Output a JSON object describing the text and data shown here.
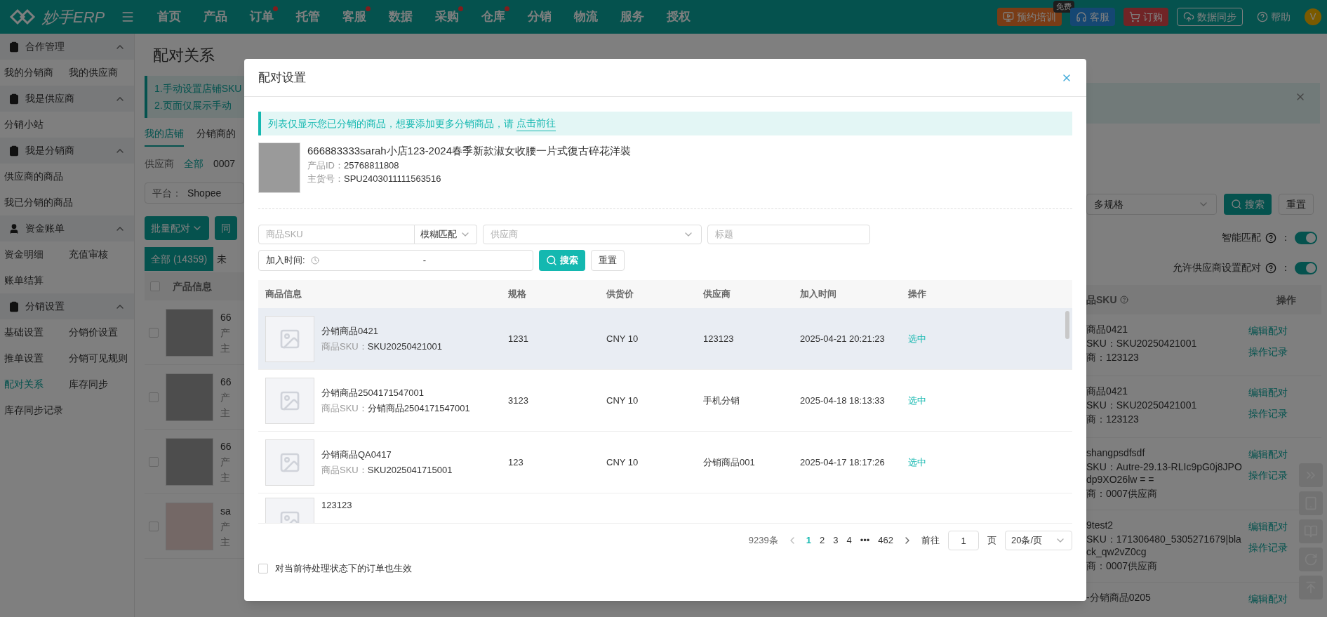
{
  "top_bar": {
    "logo": "妙手ERP",
    "nav": [
      {
        "label": "首页",
        "dot": false
      },
      {
        "label": "产品",
        "dot": false
      },
      {
        "label": "订单",
        "dot": true
      },
      {
        "label": "托管",
        "dot": false
      },
      {
        "label": "客服",
        "dot": true
      },
      {
        "label": "数据",
        "dot": false
      },
      {
        "label": "采购",
        "dot": true
      },
      {
        "label": "仓库",
        "dot": true
      },
      {
        "label": "分销",
        "dot": false
      },
      {
        "label": "物流",
        "dot": false
      },
      {
        "label": "服务",
        "dot": false
      },
      {
        "label": "授权",
        "dot": false
      }
    ],
    "actions": [
      {
        "kind": "training",
        "label": "预约培训",
        "badge": "免费"
      },
      {
        "kind": "service",
        "label": "客服"
      },
      {
        "kind": "order",
        "label": "订购"
      },
      {
        "kind": "sync",
        "label": "数据同步"
      },
      {
        "kind": "help",
        "label": "帮助"
      }
    ],
    "avatar": "V"
  },
  "sidebar": [
    {
      "title": "合作管理",
      "expanded": true,
      "items": [
        {
          "label": "我的分销商",
          "selected": false
        },
        {
          "label": "我的供应商",
          "selected": false
        }
      ]
    },
    {
      "title": "我是供应商",
      "expanded": true,
      "items": [
        {
          "label": "分销小站",
          "selected": false
        }
      ]
    },
    {
      "title": "我是分销商",
      "expanded": true,
      "items": [
        {
          "label": "供应商的商品",
          "selected": false
        },
        {
          "label": "我已分销的商品",
          "selected": false
        }
      ]
    },
    {
      "title": "资金账单",
      "expanded": true,
      "items": [
        {
          "label": "资金明细",
          "selected": false
        },
        {
          "label": "充值审核",
          "selected": false
        },
        {
          "label": "账单结算",
          "selected": false
        }
      ]
    },
    {
      "title": "分销设置",
      "expanded": true,
      "items": [
        {
          "label": "基础设置",
          "selected": false
        },
        {
          "label": "分销价设置",
          "selected": false
        },
        {
          "label": "推单设置",
          "selected": false
        },
        {
          "label": "分销可见规则",
          "selected": false
        },
        {
          "label": "配对关系",
          "selected": true
        },
        {
          "label": "库存同步",
          "selected": false
        },
        {
          "label": "库存同步记录",
          "selected": false
        }
      ]
    }
  ],
  "page_left": {
    "title": "配对关系",
    "notice_lines": [
      "1.手动设置店铺SKU",
      "2.页面仅展示手动"
    ],
    "tabs": [
      {
        "label": "我的店铺",
        "selected": true
      },
      {
        "label": "分销商的",
        "selected": false
      }
    ],
    "supplier_filter": {
      "label": "供应商",
      "options": [
        {
          "label": "全部",
          "selected": true
        },
        {
          "label": "0007",
          "selected": false
        }
      ]
    },
    "platform": {
      "label": "平台：",
      "value": "Shopee"
    },
    "buttons": [
      {
        "label": "批量配对",
        "caret": true
      },
      {
        "label": "同",
        "caret": false
      }
    ],
    "status_tabs": [
      {
        "label": "全部 (14359)",
        "selected": true
      },
      {
        "label": "未",
        "selected": false
      }
    ],
    "header_checked": false,
    "header": "产品信息",
    "rows": [
      {
        "checked": false,
        "kind": "dress",
        "lines": [
          "66",
          "产",
          "主"
        ]
      },
      {
        "checked": false,
        "kind": "dress",
        "lines": [
          "66",
          "产",
          "主"
        ]
      },
      {
        "checked": false,
        "kind": "dress",
        "lines": [
          "66",
          "产",
          "主"
        ]
      },
      {
        "checked": false,
        "kind": "fan",
        "lines": [
          "sa",
          "产",
          "主"
        ]
      }
    ]
  },
  "page_right": {
    "spec_select": "多规格",
    "search": "搜索",
    "reset": "重置",
    "switches": [
      {
        "label": "智能匹配",
        "colon": "：",
        "on": true
      },
      {
        "label": "允许供应商设置配对",
        "colon": "：",
        "on": true
      }
    ],
    "header": {
      "sku": "品SKU",
      "action": "操作"
    },
    "rows": [
      {
        "lines": [
          "商品0421",
          "SKU：SKU20250421001",
          "商：123123"
        ],
        "actions": [
          "编辑配对",
          "操作记录"
        ]
      },
      {
        "lines": [
          "商品0421",
          "SKU：SKU20250421001",
          "商：123123"
        ],
        "actions": [
          "编辑配对",
          "操作记录"
        ]
      },
      {
        "lines": [
          "shangpsdfsdf",
          "SKU：Autre-29.13-RLIc9pG0j8JPOdp9XO26lw = =",
          "商：0007供应商"
        ],
        "actions": [
          "编辑配对",
          "操作记录"
        ]
      },
      {
        "lines": [
          "9test2",
          "SKU：171306480_5305271679|black_qw2vZ0cg",
          "商：0007供应商"
        ],
        "actions": [
          "编辑配对",
          "操作记录"
        ]
      },
      {
        "lines": [
          "-分销商品0205"
        ],
        "actions": [
          "编辑配对"
        ]
      }
    ]
  },
  "modal": {
    "title": "配对设置",
    "notice": "列表仅显示您已分销的商品，想要添加更多分销商品，请",
    "notice_link": "点击前往",
    "product": {
      "title": "666883333sarah小店123-2024春季新款淑女收腰一片式復古碎花洋裝",
      "fields": [
        {
          "label": "产品ID：",
          "value": "25768811808"
        },
        {
          "label": "主货号：",
          "value": "SPU2403011111563516"
        }
      ]
    },
    "filters": {
      "sku_placeholder": "商品SKU",
      "match_mode": "模糊匹配",
      "supplier_placeholder": "供应商",
      "title_placeholder": "标题",
      "date_label": "加入时间:",
      "date_separator": "-",
      "search": "搜索",
      "reset": "重置"
    },
    "columns": [
      "商品信息",
      "规格",
      "供货价",
      "供应商",
      "加入时间",
      "操作"
    ],
    "rows": [
      {
        "name": "分销商品0421",
        "sku_label": "商品SKU：",
        "sku": "SKU20250421001",
        "spec": "1231",
        "price": "CNY 10",
        "supplier": "123123",
        "time": "2025-04-21 20:21:23",
        "action": "选中",
        "highlighted": true
      },
      {
        "name": "分销商品2504171547001",
        "sku_label": "商品SKU：",
        "sku": "分销商品2504171547001",
        "spec": "3123",
        "price": "CNY 10",
        "supplier": "手机分销",
        "time": "2025-04-18 18:13:33",
        "action": "选中",
        "highlighted": false
      },
      {
        "name": "分销商品QA0417",
        "sku_label": "商品SKU：",
        "sku": "SKU2025041715001",
        "spec": "123",
        "price": "CNY 10",
        "supplier": "分销商品001",
        "time": "2025-04-17 18:17:26",
        "action": "选中",
        "highlighted": false
      },
      {
        "name": "123123",
        "highlighted": false
      }
    ],
    "pagination": {
      "total": "9239条",
      "pages": [
        {
          "label": "1",
          "selected": true
        },
        {
          "label": "2",
          "selected": false
        },
        {
          "label": "3",
          "selected": false
        },
        {
          "label": "4",
          "selected": false
        },
        {
          "label": "•••",
          "selected": false
        },
        {
          "label": "462",
          "selected": false
        }
      ],
      "goto_label": "前往",
      "goto_value": "1",
      "page_unit": "页",
      "page_size": "20条/页"
    },
    "apply_pending": {
      "label": "对当前待处理状态下的订单也生效",
      "checked": false
    }
  }
}
